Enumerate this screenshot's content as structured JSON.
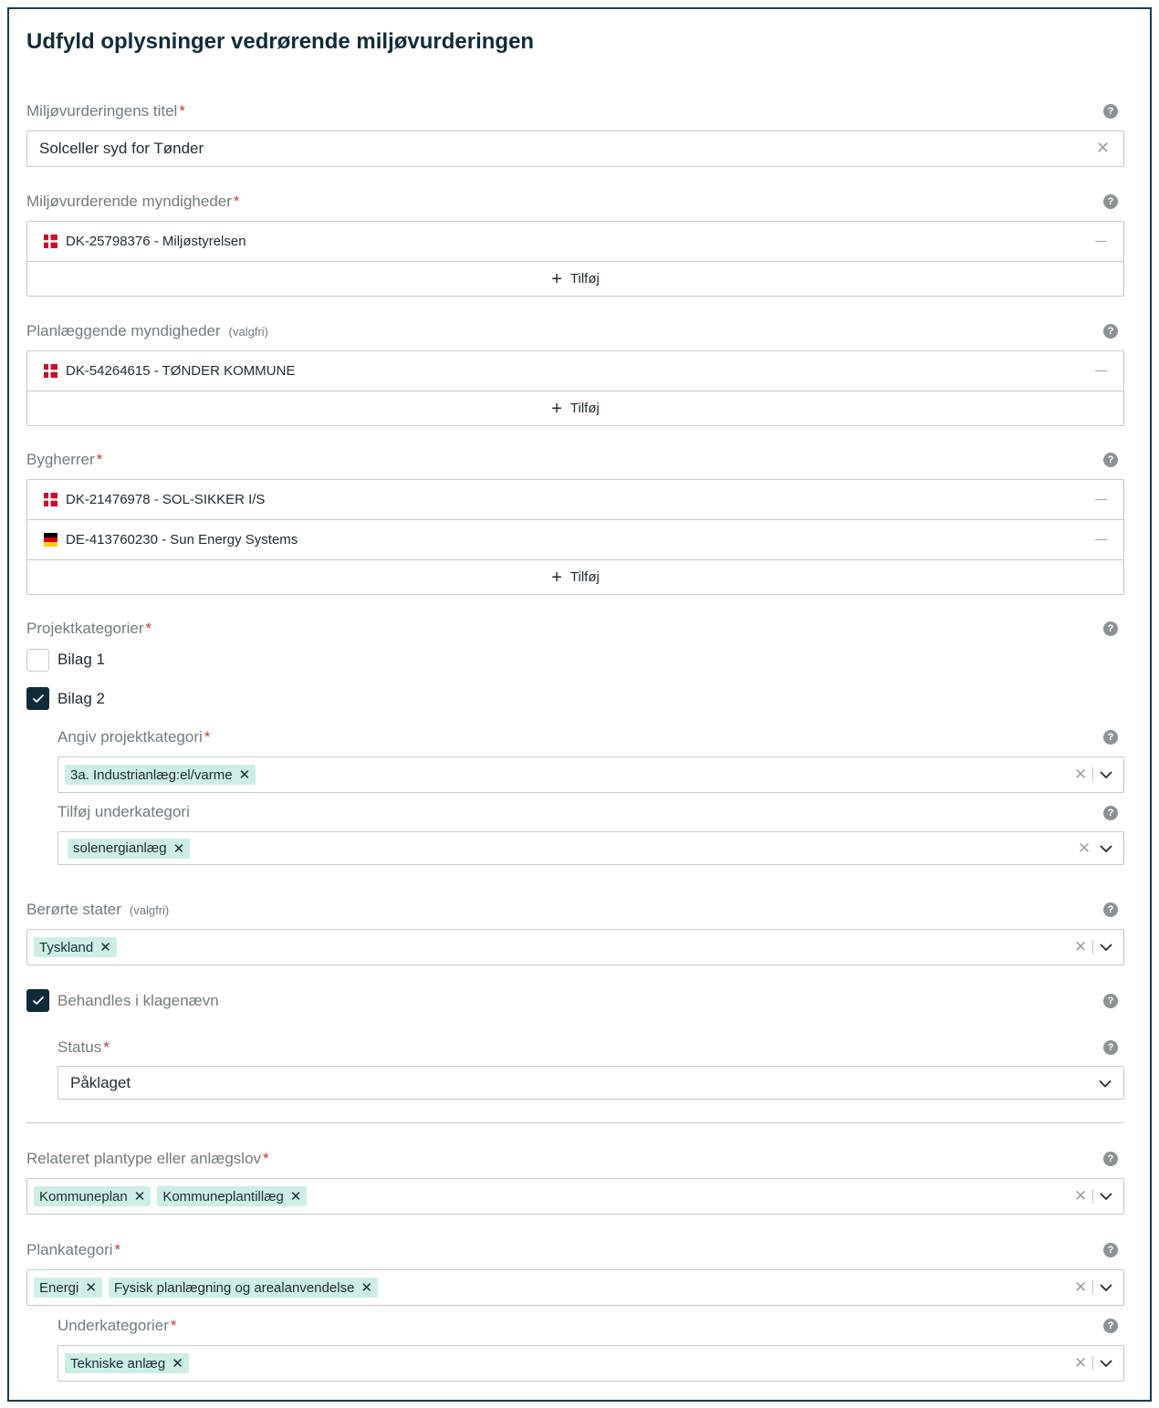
{
  "page": {
    "title": "Udfyld oplysninger vedrørende miljøvurderingen"
  },
  "colors": {
    "border": "#123e52",
    "chip": "#cdeee6",
    "checkbox_on": "#0f2b38",
    "required": "#c0392b"
  },
  "help_icon": "?",
  "title_field": {
    "label": "Miljøvurderingens titel",
    "required": "*",
    "value": "Solceller syd for Tønder"
  },
  "assessing_authorities": {
    "label": "Miljøvurderende myndigheder",
    "required": "*",
    "items": [
      {
        "flag": "DK",
        "text": "DK-25798376 - Miljøstyrelsen"
      }
    ],
    "add_label": "Tilføj"
  },
  "planning_authorities": {
    "label": "Planlæggende myndigheder",
    "optional": "(valgfri)",
    "items": [
      {
        "flag": "DK",
        "text": "DK-54264615 - TØNDER KOMMUNE"
      }
    ],
    "add_label": "Tilføj"
  },
  "developers": {
    "label": "Bygherrer",
    "required": "*",
    "items": [
      {
        "flag": "DK",
        "text": "DK-21476978 - SOL-SIKKER I/S"
      },
      {
        "flag": "DE",
        "text": "DE-413760230 - Sun Energy Systems"
      }
    ],
    "add_label": "Tilføj"
  },
  "project_categories": {
    "label": "Projektkategorier",
    "required": "*",
    "options": [
      {
        "label": "Bilag 1",
        "checked": false
      },
      {
        "label": "Bilag 2",
        "checked": true
      }
    ],
    "category": {
      "label": "Angiv projektkategori",
      "required": "*",
      "chips": [
        "3a. Industrianlæg:el/varme"
      ]
    },
    "subcategory": {
      "label": "Tilføj underkategori",
      "chips": [
        "solenergianlæg"
      ]
    }
  },
  "affected_states": {
    "label": "Berørte stater",
    "optional": "(valgfri)",
    "chips": [
      "Tyskland"
    ]
  },
  "appeals_board": {
    "label": "Behandles i klagenævn",
    "checked": true,
    "status": {
      "label": "Status",
      "required": "*",
      "value": "Påklaget"
    }
  },
  "related_plan": {
    "label": "Relateret plantype eller anlægslov",
    "required": "*",
    "chips": [
      "Kommuneplan",
      "Kommuneplantillæg"
    ]
  },
  "plan_category": {
    "label": "Plankategori",
    "required": "*",
    "chips": [
      "Energi",
      "Fysisk planlægning og arealanvendelse"
    ],
    "subcategories": {
      "label": "Underkategorier",
      "required": "*",
      "chips": [
        "Tekniske anlæg"
      ]
    }
  }
}
